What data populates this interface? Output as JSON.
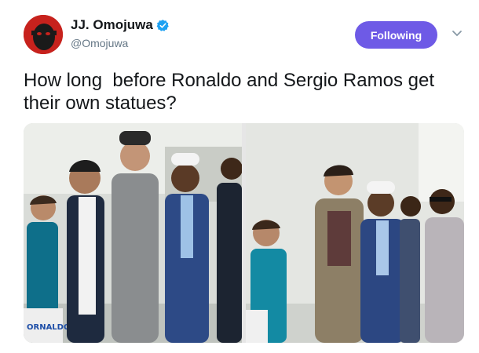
{
  "tweet": {
    "author": {
      "display_name": "JJ. Omojuwa",
      "handle": "@Omojuwa",
      "verified_icon": "verified-badge-icon"
    },
    "follow_label": "Following",
    "more_icon": "chevron-down-icon",
    "text": "How long  before Ronaldo and Sergio Ramos get their own statues?",
    "media": {
      "photo_left_caption": "ORNALDO",
      "photo_count": 2
    }
  },
  "colors": {
    "follow_button": "#6e5ae6",
    "verified_blue": "#1da1f2",
    "secondary_text": "#657786"
  }
}
